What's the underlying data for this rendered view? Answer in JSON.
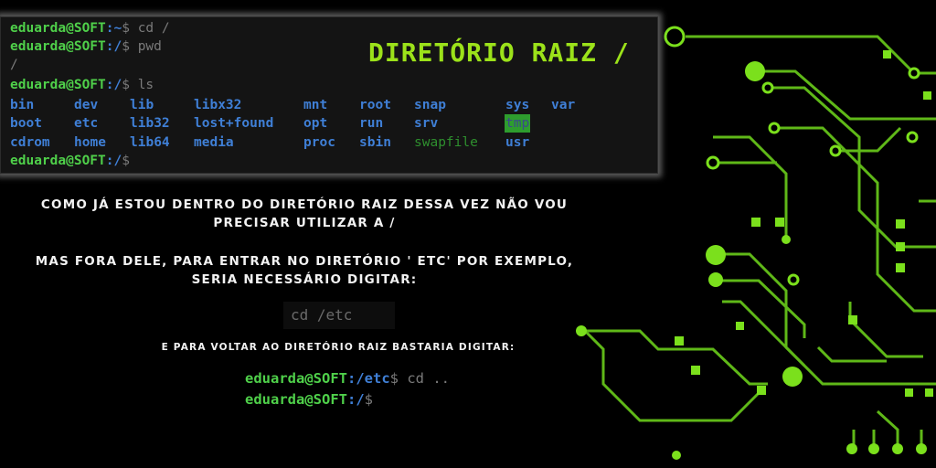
{
  "title": "DIRETÓRIO RAIZ /",
  "terminal": {
    "user": "eduarda@SOFT",
    "sep": ":",
    "lines": [
      {
        "path": "~",
        "cmd": "$ cd /"
      },
      {
        "path": "/",
        "cmd": "$ pwd"
      },
      {
        "output": "/"
      },
      {
        "path": "/",
        "cmd": "$ ls"
      }
    ],
    "dirs_row1": [
      "bin",
      "dev",
      "lib",
      "libx32",
      "mnt",
      "root",
      "snap",
      "sys",
      "var"
    ],
    "dirs_row2": [
      "boot",
      "etc",
      "lib32",
      "lost+found",
      "opt",
      "run",
      "srv",
      "tmp"
    ],
    "dirs_row3": [
      "cdrom",
      "home",
      "lib64",
      "media",
      "proc",
      "sbin",
      "swapfile",
      "usr"
    ],
    "final_prompt": {
      "path": "/",
      "cmd": "$"
    }
  },
  "captions": {
    "line1": "Como já estou dentro do diretório raiz dessa vez não vou",
    "line2": "precisar utilizar a /",
    "line3": "Mas fora dele, para entrar no diretório ' etc' por exemplo,",
    "line4": "seria necessário digitar:",
    "line5": "E para voltar ao diretório raiz bastaria digitar:"
  },
  "example_cmd": "cd /etc",
  "example_prompt": {
    "user": "eduarda@SOFT",
    "line1_path": "/etc",
    "line1_cmd": "$ cd ..",
    "line2_path": "/",
    "line2_cmd": "$"
  },
  "colors": {
    "accent": "#9ce21a",
    "user": "#4fd04a",
    "path": "#3f7fd6",
    "circuit": "#7be01c"
  }
}
